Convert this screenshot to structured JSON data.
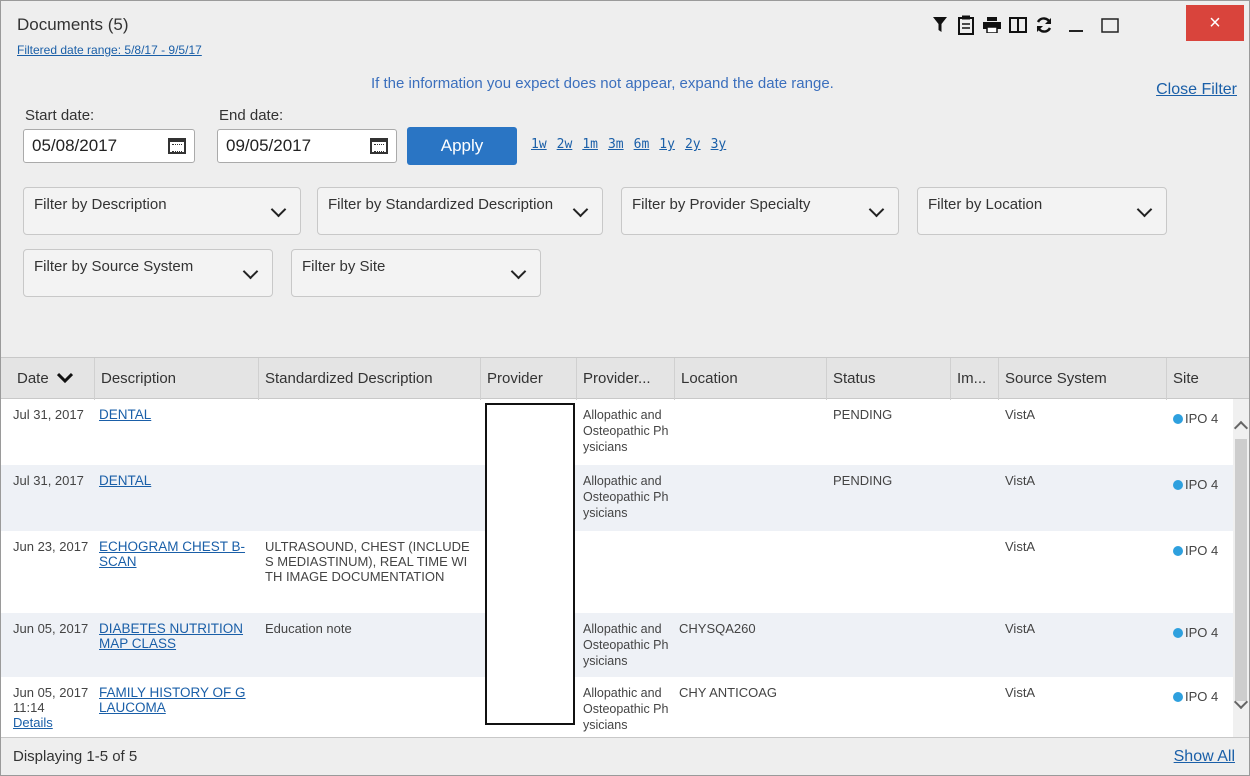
{
  "header": {
    "title": "Documents (5)",
    "filtered_range": "Filtered date range: 5/8/17 - 9/5/17",
    "close_symbol": "×"
  },
  "toolbar": {
    "icons": [
      "filter-icon",
      "clipboard-icon",
      "print-icon",
      "columns-icon",
      "refresh-icon",
      "minimize-icon",
      "maximize-icon",
      "close-icon"
    ]
  },
  "filter": {
    "info": "If the information you expect does not appear, expand the date range.",
    "close_filter": "Close Filter",
    "start_label": "Start date:",
    "end_label": "End date:",
    "start_value": "05/08/2017",
    "end_value": "09/05/2017",
    "apply": "Apply",
    "quick_ranges": [
      "1w",
      "2w",
      "1m",
      "3m",
      "6m",
      "1y",
      "2y",
      "3y"
    ],
    "dropdowns": [
      "Filter by Description",
      "Filter by Standardized Description",
      "Filter by Provider Specialty",
      "Filter by Location",
      "Filter by Source System",
      "Filter by Site"
    ]
  },
  "table": {
    "columns": [
      "Date",
      "Description",
      "Standardized Description",
      "Provider",
      "Provider...",
      "Location",
      "Status",
      "Im...",
      "Source System",
      "Site"
    ],
    "rows": [
      {
        "date": "Jul 31, 2017",
        "desc": "DENTAL",
        "std": "",
        "spec": "Allopathic and Osteopathic Physicians",
        "loc": "",
        "status": "PENDING",
        "src": "VistA",
        "site": "IPO 4",
        "details": ""
      },
      {
        "date": "Jul 31, 2017",
        "desc": "DENTAL",
        "std": "",
        "spec": "Allopathic and Osteopathic Physicians",
        "loc": "",
        "status": "PENDING",
        "src": "VistA",
        "site": "IPO 4",
        "details": ""
      },
      {
        "date": "Jun 23, 2017",
        "desc": "ECHOGRAM CHEST B-SCAN",
        "std": "ULTRASOUND, CHEST (INCLUDES MEDIASTINUM), REAL TIME WITH IMAGE DOCUMENTATION",
        "spec": "",
        "loc": "",
        "status": "",
        "src": "VistA",
        "site": "IPO 4",
        "details": ""
      },
      {
        "date": "Jun 05, 2017",
        "desc": "DIABETES NUTRITION MAP CLASS",
        "std": "Education note",
        "spec": "Allopathic and Osteopathic Physicians",
        "loc": "CHYSQA260",
        "status": "",
        "src": "VistA",
        "site": "IPO 4",
        "details": ""
      },
      {
        "date": "Jun 05, 2017 11:14",
        "desc": "FAMILY HISTORY OF GLAUCOMA",
        "std": "",
        "spec": "Allopathic and Osteopathic Physicians",
        "loc": "CHY ANTICOAG",
        "status": "",
        "src": "VistA",
        "site": "IPO 4",
        "details": "Details"
      }
    ]
  },
  "footer": {
    "displaying": "Displaying 1-5 of 5",
    "show_all": "Show All"
  }
}
